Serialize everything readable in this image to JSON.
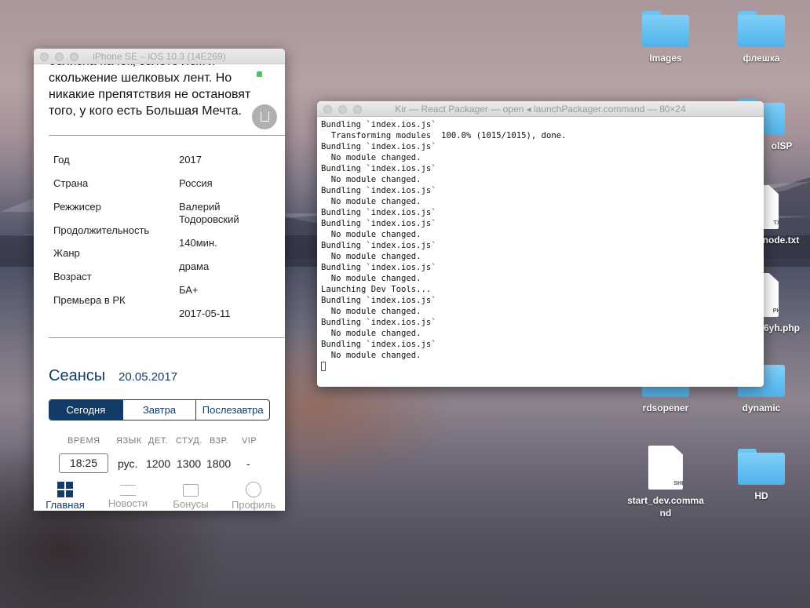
{
  "simulator": {
    "title": "iPhone SE – iOS 10.3 (14E269)",
    "description_lines": [
      "белизна пачек, золото лож и",
      "скольжение шелковых лент. Но",
      "никакие препятствия не остановят",
      "того, у кого есть Большая Мечта."
    ],
    "info": [
      {
        "label": "Год",
        "value": "2017"
      },
      {
        "label": "Страна",
        "value": "Россия"
      },
      {
        "label": "Режжисер",
        "value": "Валерий Тодоровский"
      },
      {
        "label": "Продолжительность",
        "value": "140мин."
      },
      {
        "label": "Жанр",
        "value": "драма"
      },
      {
        "label": "Возраст",
        "value": "БА+"
      },
      {
        "label": "Премьера в РК",
        "value": "2017-05-11"
      }
    ],
    "sessions_title": "Сеансы",
    "sessions_date": "20.05.2017",
    "day_tabs": [
      "Сегодня",
      "Завтра",
      "Послезавтра"
    ],
    "active_day_tab": "Сегодня",
    "columns": [
      "ВРЕМЯ",
      "ЯЗЫК",
      "ДЕТ.",
      "СТУД.",
      "ВЗР.",
      "VIP"
    ],
    "session_row": {
      "time": "18:25",
      "lang": "рус.",
      "child": "1200",
      "student": "1300",
      "adult": "1800",
      "vip": "-"
    },
    "tabbar": [
      {
        "label": "Главная",
        "icon": "grid-icon",
        "active": true
      },
      {
        "label": "Новости",
        "icon": "news-icon",
        "active": false
      },
      {
        "label": "Бонусы",
        "icon": "gift-icon",
        "active": false
      },
      {
        "label": "Профиль",
        "icon": "user-icon",
        "active": false
      }
    ],
    "accent_color": "#123c66"
  },
  "terminal": {
    "title": "Kir — React Packager — open ◂ launchPackager.command — 80×24",
    "lines": [
      "Bundling `index.ios.js`",
      "  Transforming modules  100.0% (1015/1015), done.",
      "Bundling `index.ios.js`",
      "  No module changed.",
      "Bundling `index.ios.js`",
      "  No module changed.",
      "Bundling `index.ios.js`",
      "  No module changed.",
      "Bundling `index.ios.js`",
      "Bundling `index.ios.js`",
      "  No module changed.",
      "Bundling `index.ios.js`",
      "  No module changed.",
      "Bundling `index.ios.js`",
      "  No module changed.",
      "Launching Dev Tools...",
      "Bundling `index.ios.js`",
      "  No module changed.",
      "Bundling `index.ios.js`",
      "  No module changed.",
      "Bundling `index.ios.js`",
      "  No module changed."
    ]
  },
  "desktop": {
    "items": [
      {
        "label": "Images",
        "kind": "folder"
      },
      {
        "label": "флешка",
        "kind": "folder"
      },
      {
        "label": "olSP",
        "kind": "folder"
      },
      {
        "label": "node.txt",
        "kind": "file",
        "type": "TXT"
      },
      {
        "label": "6yh.php",
        "kind": "file",
        "type": "PHP"
      },
      {
        "label": "rdsopener",
        "kind": "folder"
      },
      {
        "label": "dynamic",
        "kind": "folder"
      },
      {
        "label": "start_dev.command",
        "kind": "file",
        "type": "SHELL"
      },
      {
        "label": "HD",
        "kind": "folder"
      }
    ]
  }
}
